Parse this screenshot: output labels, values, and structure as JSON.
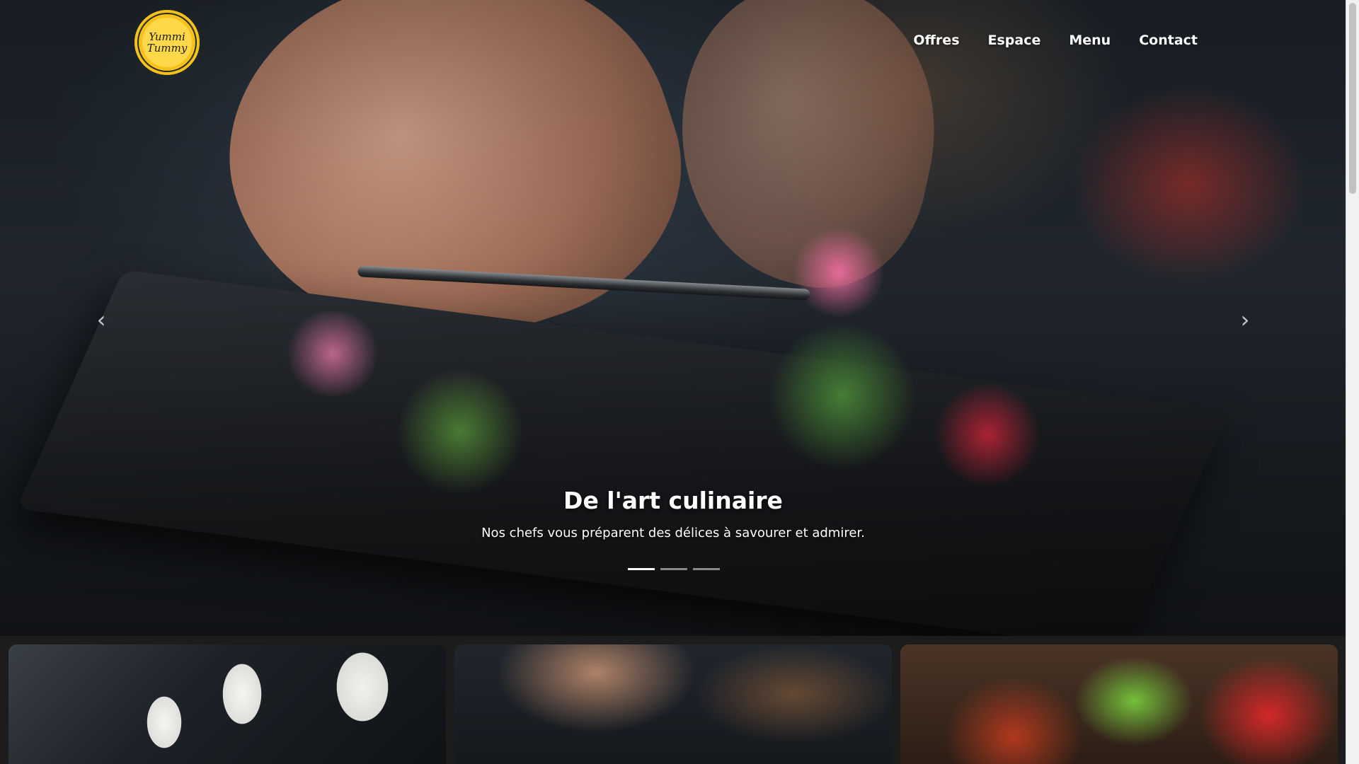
{
  "header": {
    "logo": {
      "line1": "Yummi",
      "line2": "Tummy",
      "color": "#f4c21b"
    },
    "nav": [
      {
        "label": "Offres"
      },
      {
        "label": "Espace"
      },
      {
        "label": "Menu"
      },
      {
        "label": "Contact"
      }
    ]
  },
  "carousel": {
    "prev_icon": "chevron-left-icon",
    "next_icon": "chevron-right-icon",
    "prev_glyph": "‹",
    "next_glyph": "›",
    "slide": {
      "title": "De l'art culinaire",
      "subtitle": "Nos chefs vous préparent des délices à savourer et admirer."
    },
    "indicators": {
      "count": 3,
      "active": 0
    }
  },
  "cards": [
    {
      "name": "chefs"
    },
    {
      "name": "plating"
    },
    {
      "name": "salad"
    }
  ]
}
